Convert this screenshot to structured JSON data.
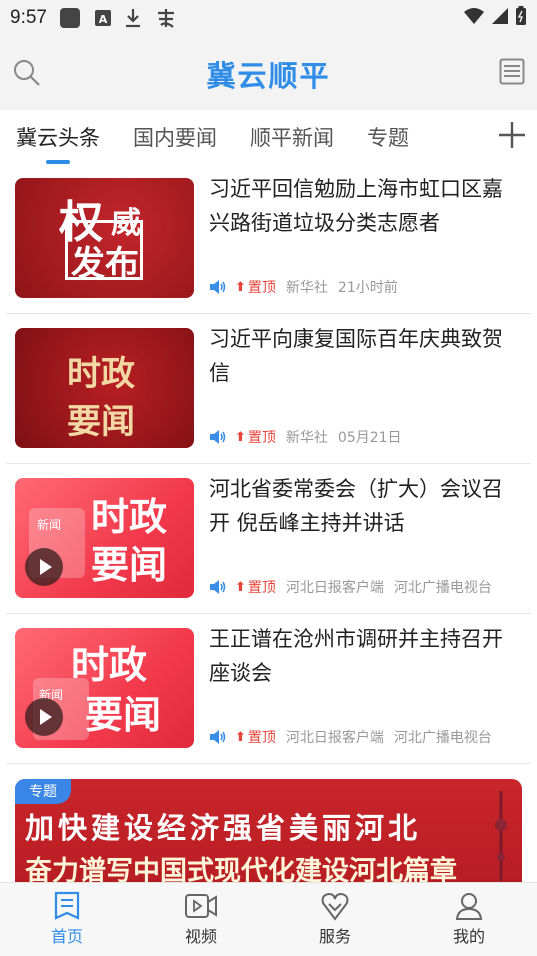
{
  "status_bar": {
    "time": "9:57"
  },
  "header": {
    "title": "冀云顺平",
    "accent_color": "#2f8de8"
  },
  "tabs": [
    {
      "label": "冀云头条",
      "active": true
    },
    {
      "label": "国内要闻",
      "active": false
    },
    {
      "label": "顺平新闻",
      "active": false
    },
    {
      "label": "专题",
      "active": false
    }
  ],
  "news": [
    {
      "title": "习近平回信勉励上海市虹口区嘉兴路街道垃圾分类志愿者",
      "pin_label": "置顶",
      "source": "新华社",
      "time": "21小时前",
      "thumb_text": [
        "权",
        "威",
        "发布"
      ],
      "has_video": false
    },
    {
      "title": "习近平向康复国际百年庆典致贺信",
      "pin_label": "置顶",
      "source": "新华社",
      "time": "05月21日",
      "thumb_text": [
        "时政",
        "要闻"
      ],
      "has_video": false
    },
    {
      "title": "河北省委常委会（扩大）会议召开 倪岳峰主持并讲话",
      "pin_label": "置顶",
      "source": "河北日报客户端",
      "time": "河北广播电视台",
      "thumb_text": [
        "新闻",
        "时政",
        "要闻"
      ],
      "has_video": true
    },
    {
      "title": "王正谱在沧州市调研并主持召开座谈会",
      "pin_label": "置顶",
      "source": "河北日报客户端",
      "time": "河北广播电视台",
      "thumb_text": [
        "时政",
        "新闻",
        "要闻"
      ],
      "has_video": true
    }
  ],
  "banner": {
    "tag": "专题",
    "line1": "加快建设经济强省美丽河北",
    "line2": "奋力谱写中国式现代化建设河北篇章"
  },
  "bottom_nav": [
    {
      "label": "首页",
      "icon": "home-doc-icon",
      "active": true
    },
    {
      "label": "视频",
      "icon": "video-icon",
      "active": false
    },
    {
      "label": "服务",
      "icon": "service-heart-icon",
      "active": false
    },
    {
      "label": "我的",
      "icon": "person-icon",
      "active": false
    }
  ]
}
